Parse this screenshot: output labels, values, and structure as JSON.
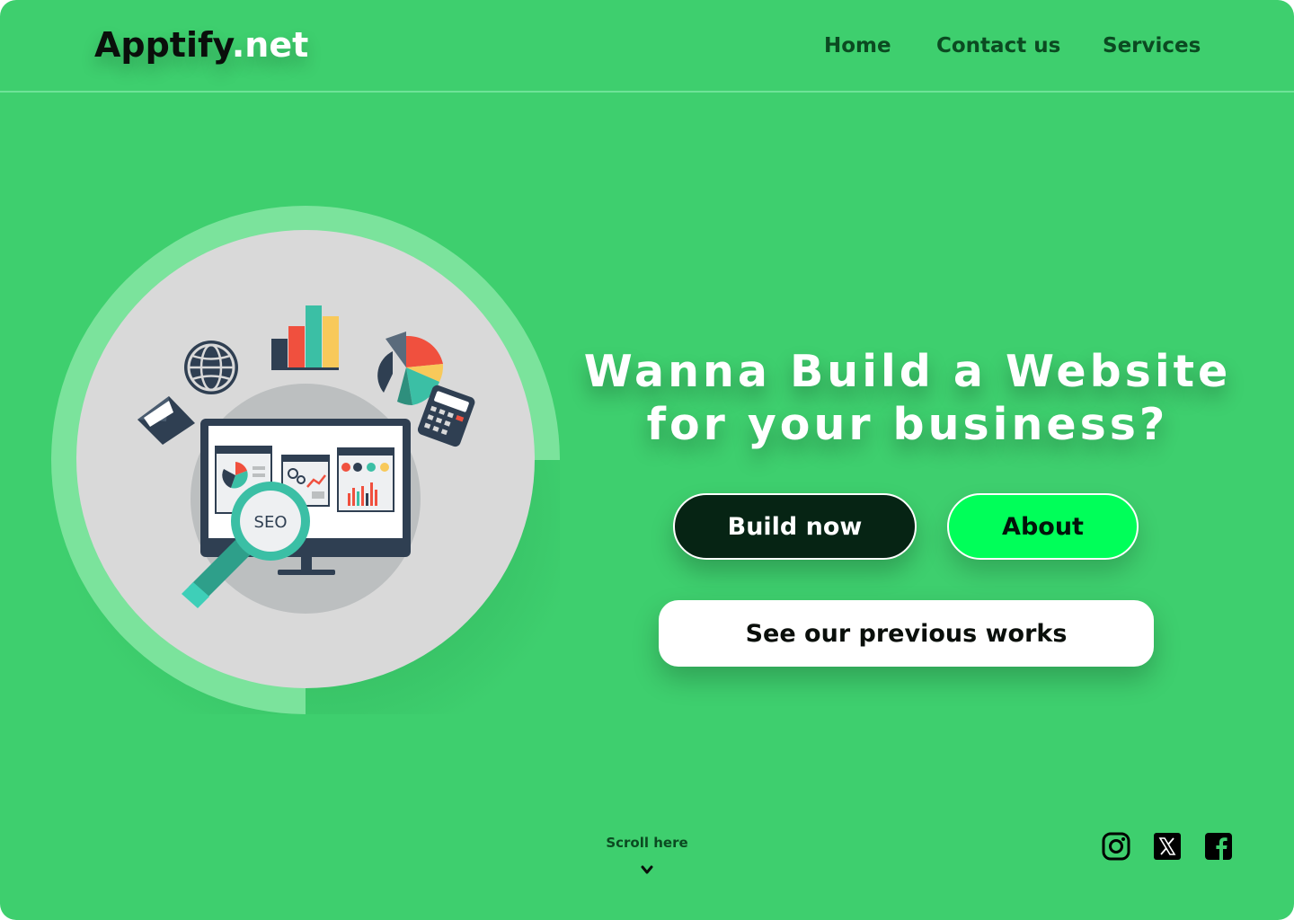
{
  "brand": {
    "name": "Apptify",
    "tld": ".net"
  },
  "nav": {
    "items": [
      {
        "label": "Home"
      },
      {
        "label": "Contact us"
      },
      {
        "label": "Services"
      }
    ]
  },
  "hero": {
    "headline": "Wanna Build a Website for your business?",
    "illustration_badge": "SEO",
    "buttons": {
      "build": "Build now",
      "about": "About",
      "works": "See our previous works"
    }
  },
  "footer": {
    "scroll_label": "Scroll here",
    "social_icons": [
      "instagram-icon",
      "x-icon",
      "facebook-icon"
    ]
  },
  "colors": {
    "background": "#3ecf6e",
    "accent": "#00ff59",
    "dark": "#062414",
    "nav_text": "#0b4a21",
    "ring": "#7be39c"
  }
}
